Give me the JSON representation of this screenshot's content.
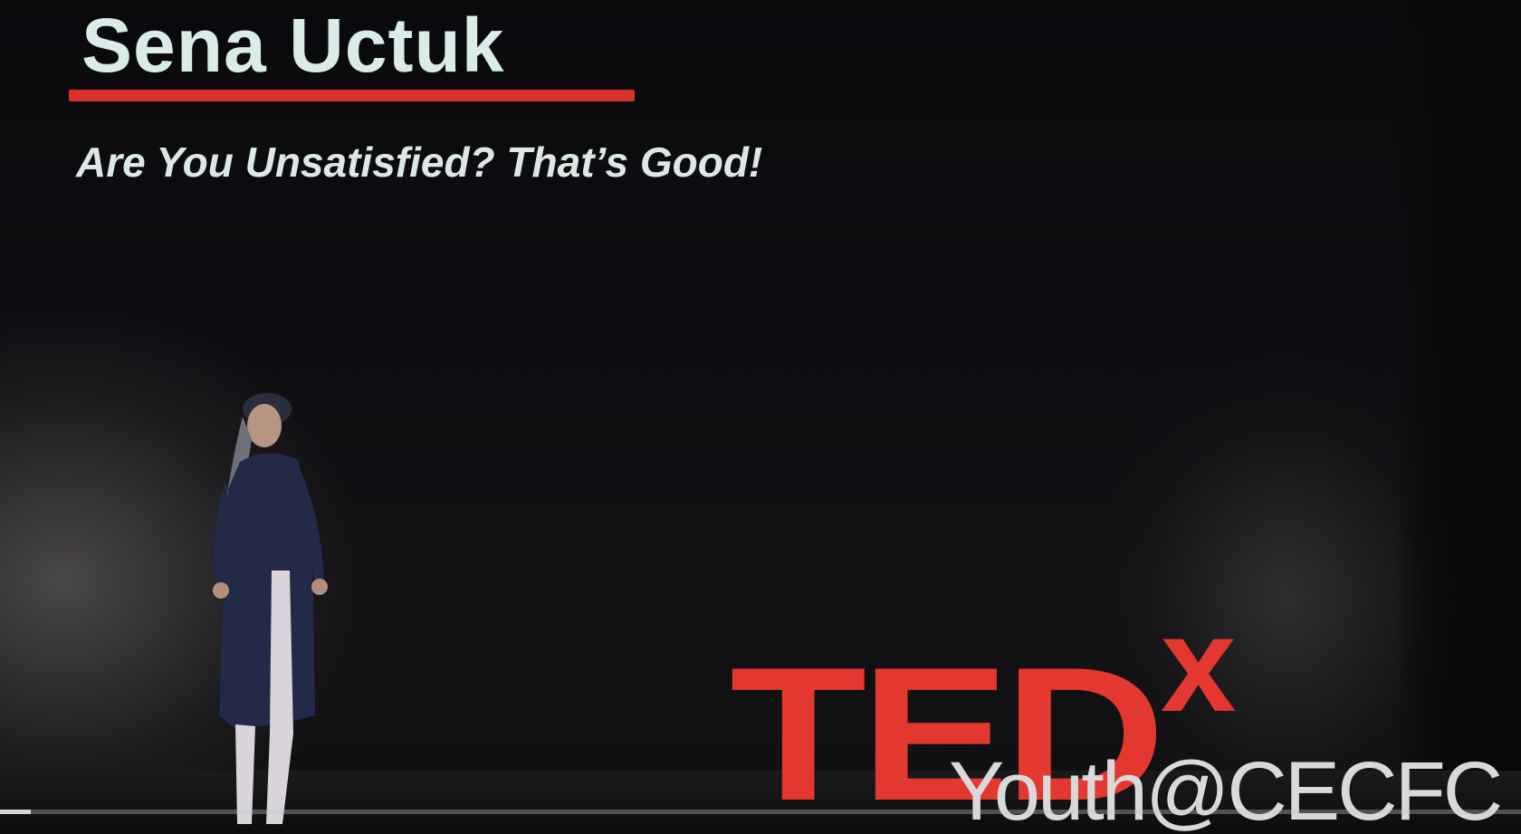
{
  "video": {
    "speaker_name": "Sena Uctuk",
    "talk_title": "Are You Unsatisfied? That’s Good!",
    "logo": {
      "main": "TED",
      "superscript": "x",
      "event": "Youth@CECFC"
    },
    "progress_fraction": 0.02
  },
  "colors": {
    "accent_red": "#d8322c",
    "title_text": "#d9ece8",
    "background": "#0b0b0d"
  }
}
